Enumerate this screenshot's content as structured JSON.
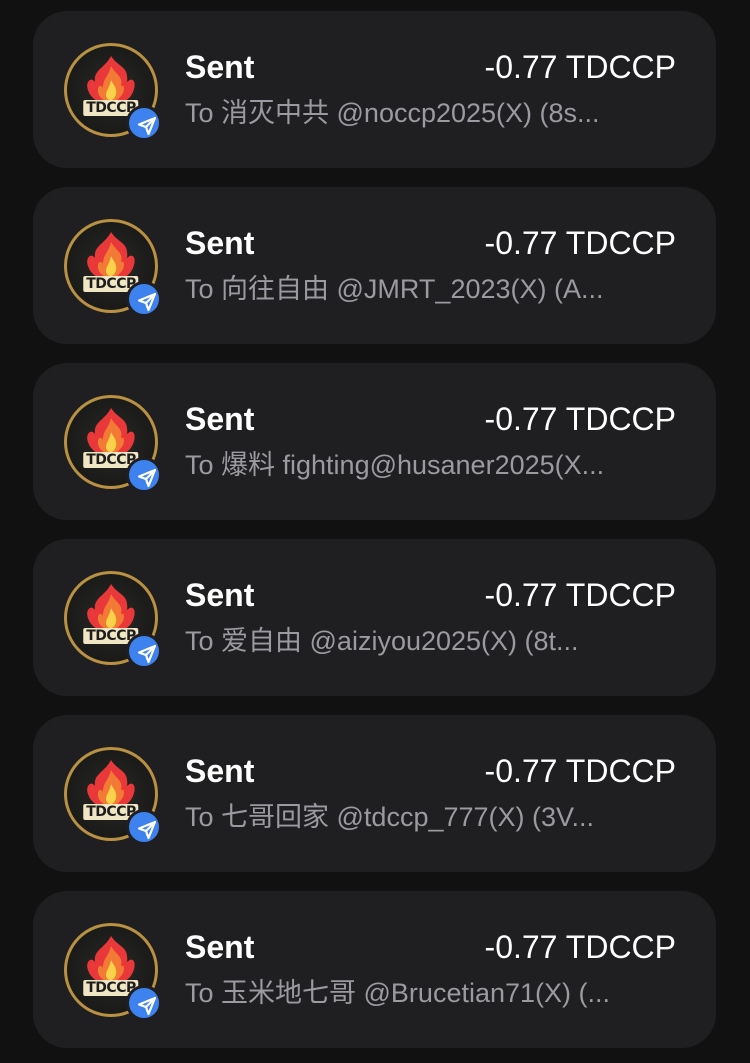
{
  "transactions": [
    {
      "status": "Sent",
      "amount": "-0.77 TDCCP",
      "to": "To 消灭中共 @noccp2025(X) (8s...",
      "token_logo_text": "TDCCP"
    },
    {
      "status": "Sent",
      "amount": "-0.77 TDCCP",
      "to": "To 向往自由 @JMRT_2023(X) (A...",
      "token_logo_text": "TDCCP"
    },
    {
      "status": "Sent",
      "amount": "-0.77 TDCCP",
      "to": "To 爆料 fighting@husaner2025(X...",
      "token_logo_text": "TDCCP"
    },
    {
      "status": "Sent",
      "amount": "-0.77 TDCCP",
      "to": "To 爱自由 @aiziyou2025(X) (8t...",
      "token_logo_text": "TDCCP"
    },
    {
      "status": "Sent",
      "amount": "-0.77 TDCCP",
      "to": "To 七哥回家 @tdccp_777(X) (3V...",
      "token_logo_text": "TDCCP"
    },
    {
      "status": "Sent",
      "amount": "-0.77 TDCCP",
      "to": "To 玉米地七哥 @Brucetian71(X) (...",
      "token_logo_text": "TDCCP"
    }
  ],
  "icons": {
    "token": "flame-coin-icon",
    "badge": "send-arrow-icon"
  },
  "colors": {
    "background": "#111111",
    "card": "#1f1f21",
    "badge": "#3d82ee",
    "secondary_text": "#9a9aa0"
  }
}
